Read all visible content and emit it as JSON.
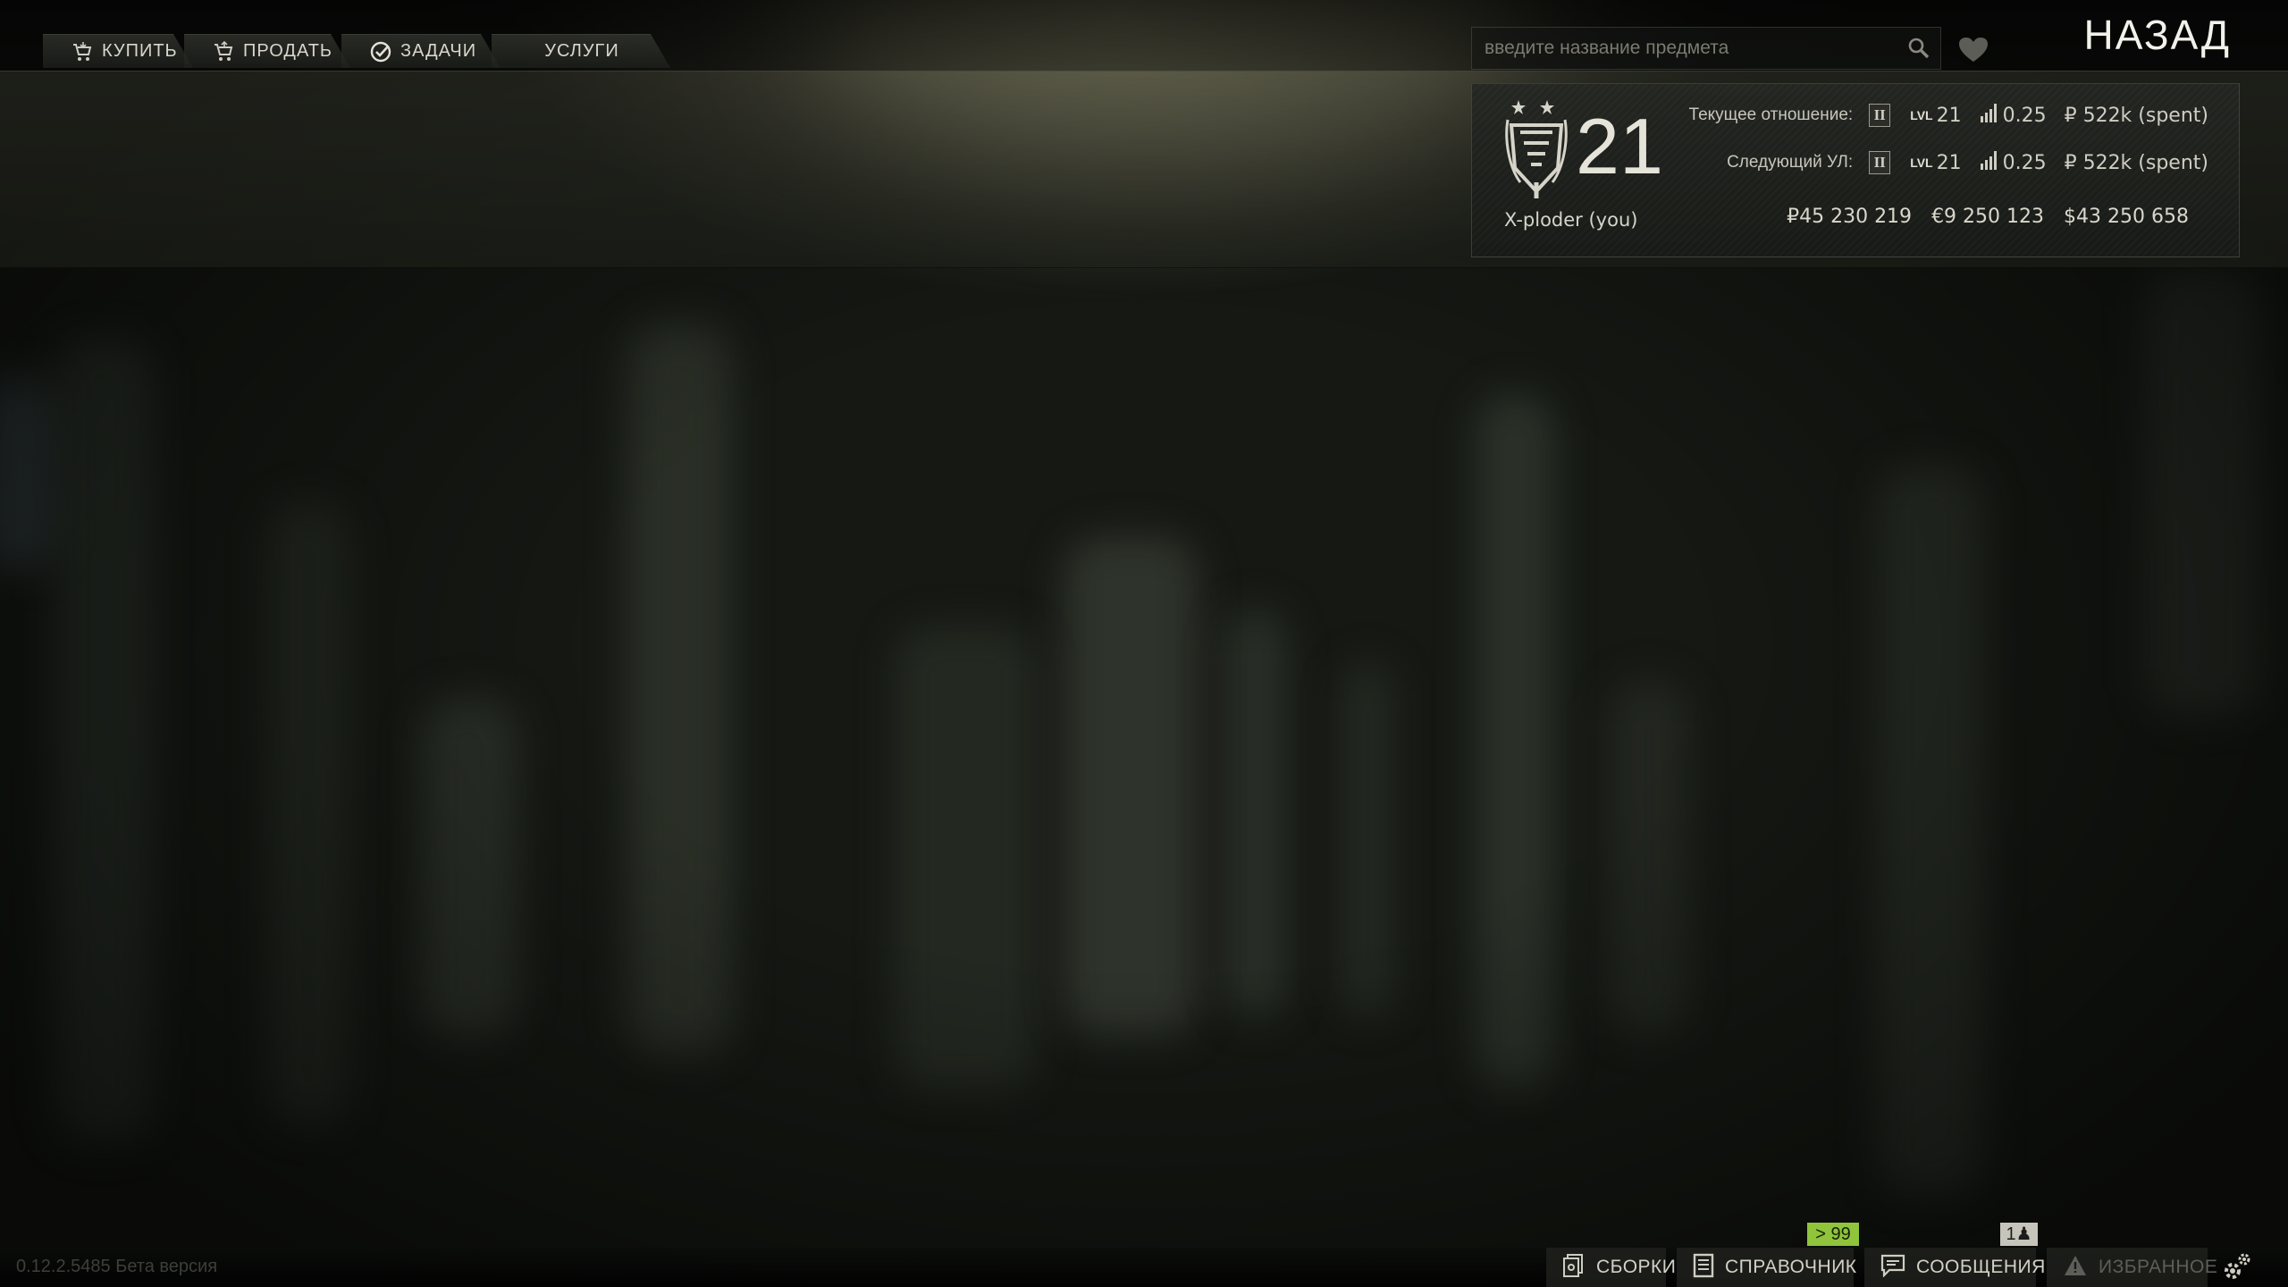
{
  "tabs": [
    {
      "label": "КУПИТЬ",
      "icon": "cart-icon"
    },
    {
      "label": "ПРОДАТЬ",
      "icon": "cart-sell-icon"
    },
    {
      "label": "ЗАДАЧИ",
      "icon": "check-circle-icon"
    },
    {
      "label": "УСЛУГИ",
      "icon": ""
    }
  ],
  "search": {
    "placeholder": "введите название предмета",
    "icon": "search-icon"
  },
  "favorite_icon": "heart-icon",
  "back_label": "НАЗАД",
  "trader": {
    "level": "21",
    "name": "X-ploder (you)",
    "current": {
      "label": "Текущее отношение:",
      "loyalty": "II",
      "lvl_tag": "LVL",
      "lvl": "21",
      "rep": "0.25",
      "spent": "₽ 522k (spent)"
    },
    "next": {
      "label": "Следующий УЛ:",
      "loyalty": "II",
      "lvl_tag": "LVL",
      "lvl": "21",
      "rep": "0.25",
      "spent": "₽ 522k (spent)"
    },
    "money": {
      "rub": "₽45 230 219",
      "eur": "€9 250 123",
      "usd": "$43 250 658"
    }
  },
  "bottom": {
    "version": "0.12.2.5485 Бета версия",
    "items": [
      {
        "label": "СБОРКИ",
        "icon": "builds-icon"
      },
      {
        "label": "СПРАВОЧНИК",
        "icon": "handbook-icon"
      },
      {
        "label": "СООБЩЕНИЯ",
        "icon": "messages-icon"
      },
      {
        "label": "ИЗБРАННОЕ",
        "icon": "warning-icon"
      }
    ],
    "messages_badge": "> 99",
    "friends_badge": "1"
  },
  "colors": {
    "accent_green": "#8fc43b",
    "text": "#c9c8bd",
    "panel": "#24261f"
  }
}
